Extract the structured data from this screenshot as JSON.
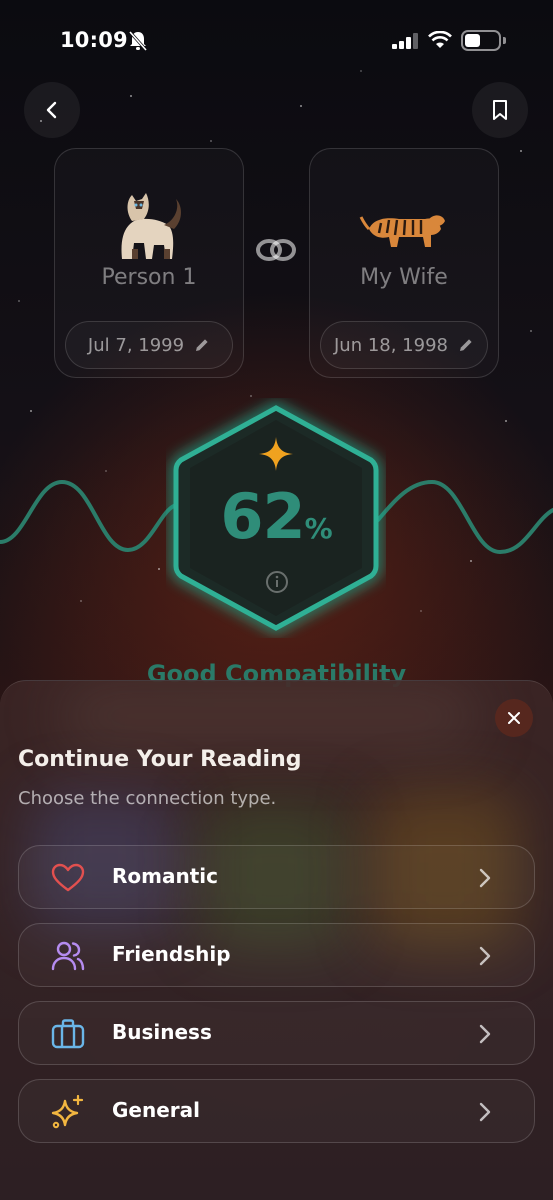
{
  "status_bar": {
    "time": "10:09"
  },
  "person1": {
    "name": "Person 1",
    "birth_date": "Jul 7, 1999",
    "animal_icon": "siamese-cat"
  },
  "person2": {
    "name": "My Wife",
    "birth_date": "Jun 18, 1998",
    "animal_icon": "tiger"
  },
  "compatibility": {
    "percent": "62",
    "percent_sign": "%",
    "label": "Good Compatibility",
    "accent_color": "#2f8d79"
  },
  "sheet": {
    "title": "Continue Your Reading",
    "subtitle": "Choose the connection type.",
    "options": [
      {
        "label": "Romantic",
        "icon": "heart-icon",
        "color": "#e2504f"
      },
      {
        "label": "Friendship",
        "icon": "users-icon",
        "color": "#b58cf0"
      },
      {
        "label": "Business",
        "icon": "briefcase-icon",
        "color": "#6ab6e8"
      },
      {
        "label": "General",
        "icon": "sparkles-icon",
        "color": "#f2b640"
      }
    ]
  }
}
